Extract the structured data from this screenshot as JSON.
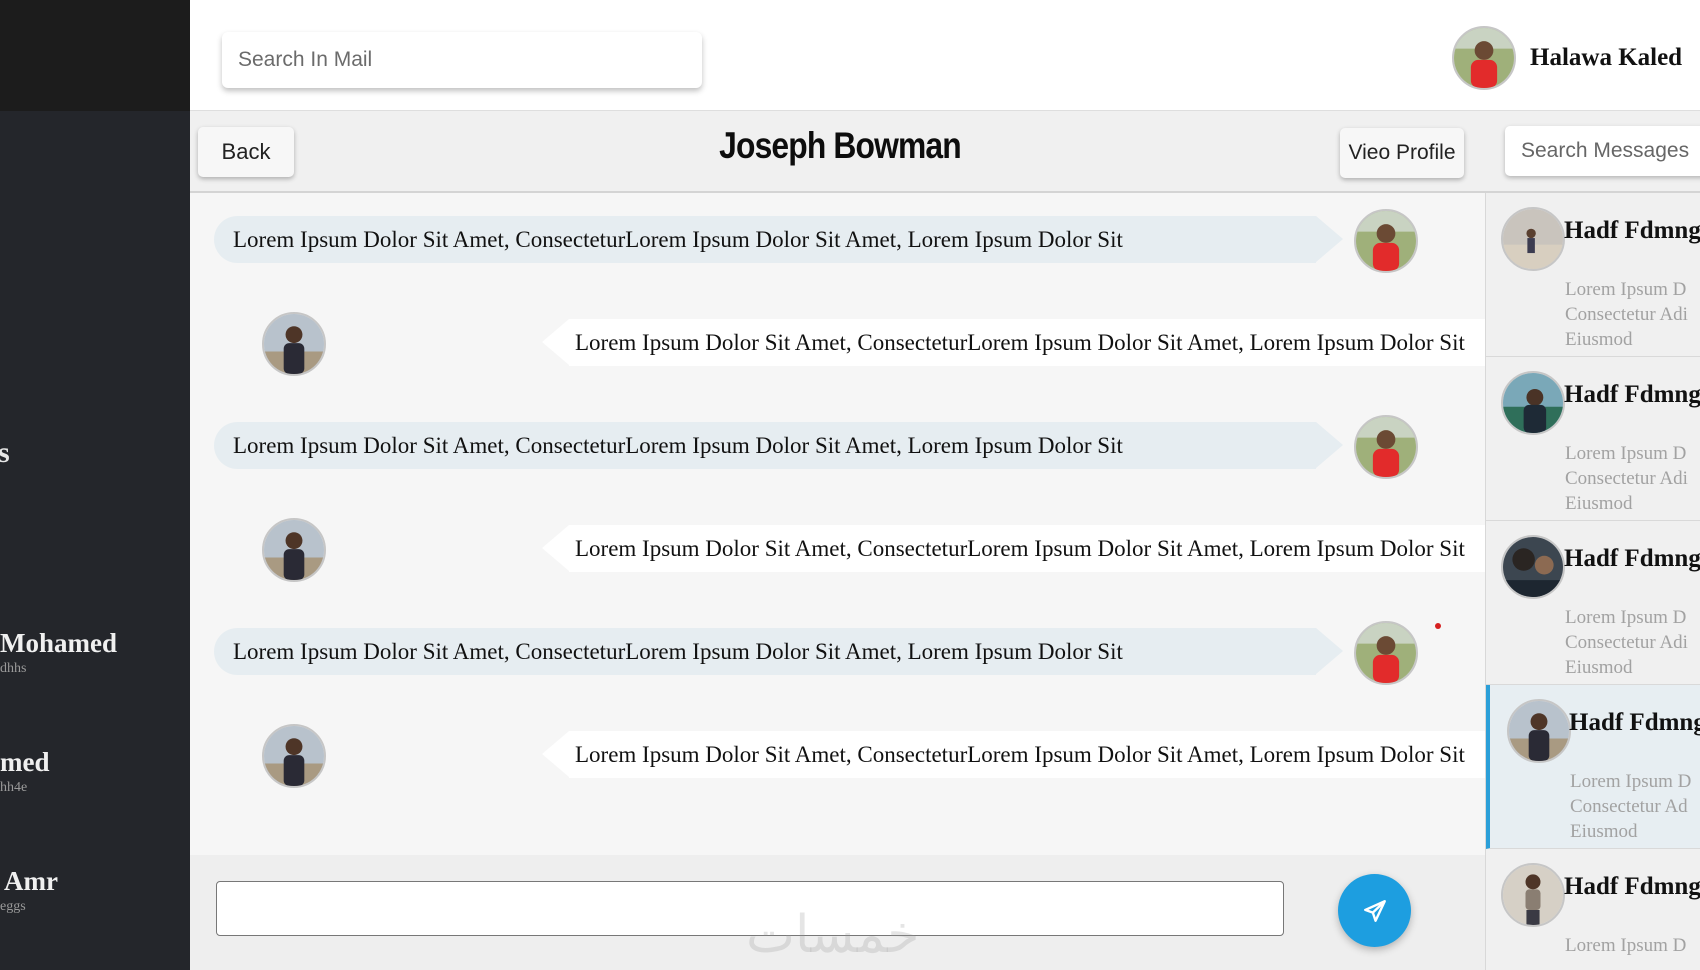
{
  "topbar": {
    "search_placeholder": "Search In Mail",
    "user_name": "Halawa Kaled"
  },
  "sidebar": {
    "heading_fragment": "s",
    "contacts": [
      {
        "name": "Mohamed",
        "sub": "dhhs"
      },
      {
        "name": "med",
        "sub": "hh4e"
      },
      {
        "name": "Amr",
        "sub": "eggs"
      }
    ]
  },
  "chat": {
    "back_label": "Back",
    "title": "Joseph Bowman",
    "view_profile_label": "Vieo Profile",
    "search_messages_placeholder": "Search Messages",
    "messages": [
      {
        "direction": "sent",
        "text": "Lorem Ipsum Dolor Sit Amet, ConsecteturLorem Ipsum Dolor Sit Amet, Lorem Ipsum Dolor Sit"
      },
      {
        "direction": "received",
        "text": "Lorem Ipsum Dolor Sit Amet, ConsecteturLorem Ipsum Dolor Sit Amet, Lorem Ipsum Dolor Sit"
      },
      {
        "direction": "sent",
        "text": "Lorem Ipsum Dolor Sit Amet, ConsecteturLorem Ipsum Dolor Sit Amet, Lorem Ipsum Dolor Sit"
      },
      {
        "direction": "received",
        "text": "Lorem Ipsum Dolor Sit Amet, ConsecteturLorem Ipsum Dolor Sit Amet, Lorem Ipsum Dolor Sit"
      },
      {
        "direction": "sent",
        "text": "Lorem Ipsum Dolor Sit Amet, ConsecteturLorem Ipsum Dolor Sit Amet, Lorem Ipsum Dolor Sit"
      },
      {
        "direction": "received",
        "text": "Lorem Ipsum Dolor Sit Amet, ConsecteturLorem Ipsum Dolor Sit Amet, Lorem Ipsum Dolor Sit"
      }
    ]
  },
  "compose": {
    "send_icon": "paper-plane-icon",
    "watermark": "خمسات"
  },
  "conversations": [
    {
      "name": "Hadf Fdmng",
      "snippet": [
        "Lorem Ipsum D",
        "Consectetur Adi",
        "Eiusmod"
      ],
      "active": false
    },
    {
      "name": "Hadf Fdmng",
      "snippet": [
        "Lorem Ipsum D",
        "Consectetur Adi",
        "Eiusmod"
      ],
      "active": false
    },
    {
      "name": "Hadf Fdmng",
      "snippet": [
        "Lorem Ipsum D",
        "Consectetur Adi",
        "Eiusmod"
      ],
      "active": false
    },
    {
      "name": "Hadf Fdmng",
      "snippet": [
        "Lorem Ipsum D",
        "Consectetur Ad",
        "Eiusmod"
      ],
      "active": true
    },
    {
      "name": "Hadf Fdmng",
      "snippet": [
        "Lorem Ipsum D"
      ],
      "active": false
    }
  ],
  "colors": {
    "sidebar": "#24262b",
    "accent": "#1d9ee0",
    "sent_bubble": "#e6edf1",
    "received_bubble": "#ffffff"
  }
}
